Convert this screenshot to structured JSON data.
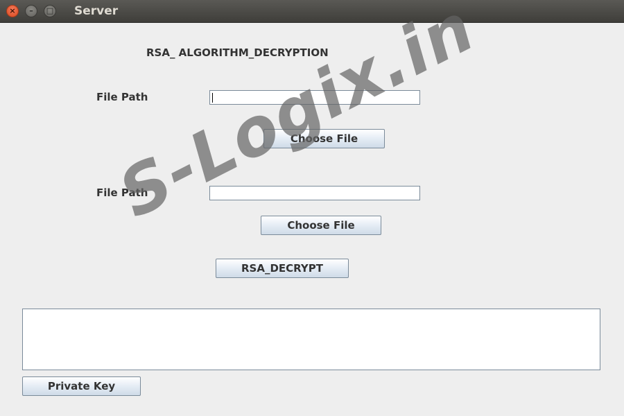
{
  "window": {
    "title": "Server",
    "close_glyph": "×",
    "minimize_glyph": "–",
    "maximize_glyph": "□"
  },
  "form": {
    "heading": "RSA_ ALGORITHM_DECRYPTION",
    "file_path_label_1": "File Path",
    "file_path_value_1": "",
    "choose_file_label_1": "Choose File",
    "file_path_label_2": "File Path",
    "file_path_value_2": "",
    "choose_file_label_2": "Choose File",
    "decrypt_label": "RSA_DECRYPT",
    "output_text": "",
    "private_key_label": "Private Key"
  },
  "watermark": {
    "text": "S-Logix.in"
  },
  "colors": {
    "titlebar": "#3f3e3a",
    "close_button": "#e4582f",
    "background": "#eeeeee",
    "button_gradient_bottom": "#cfdbe8",
    "border": "#7a8a99"
  }
}
